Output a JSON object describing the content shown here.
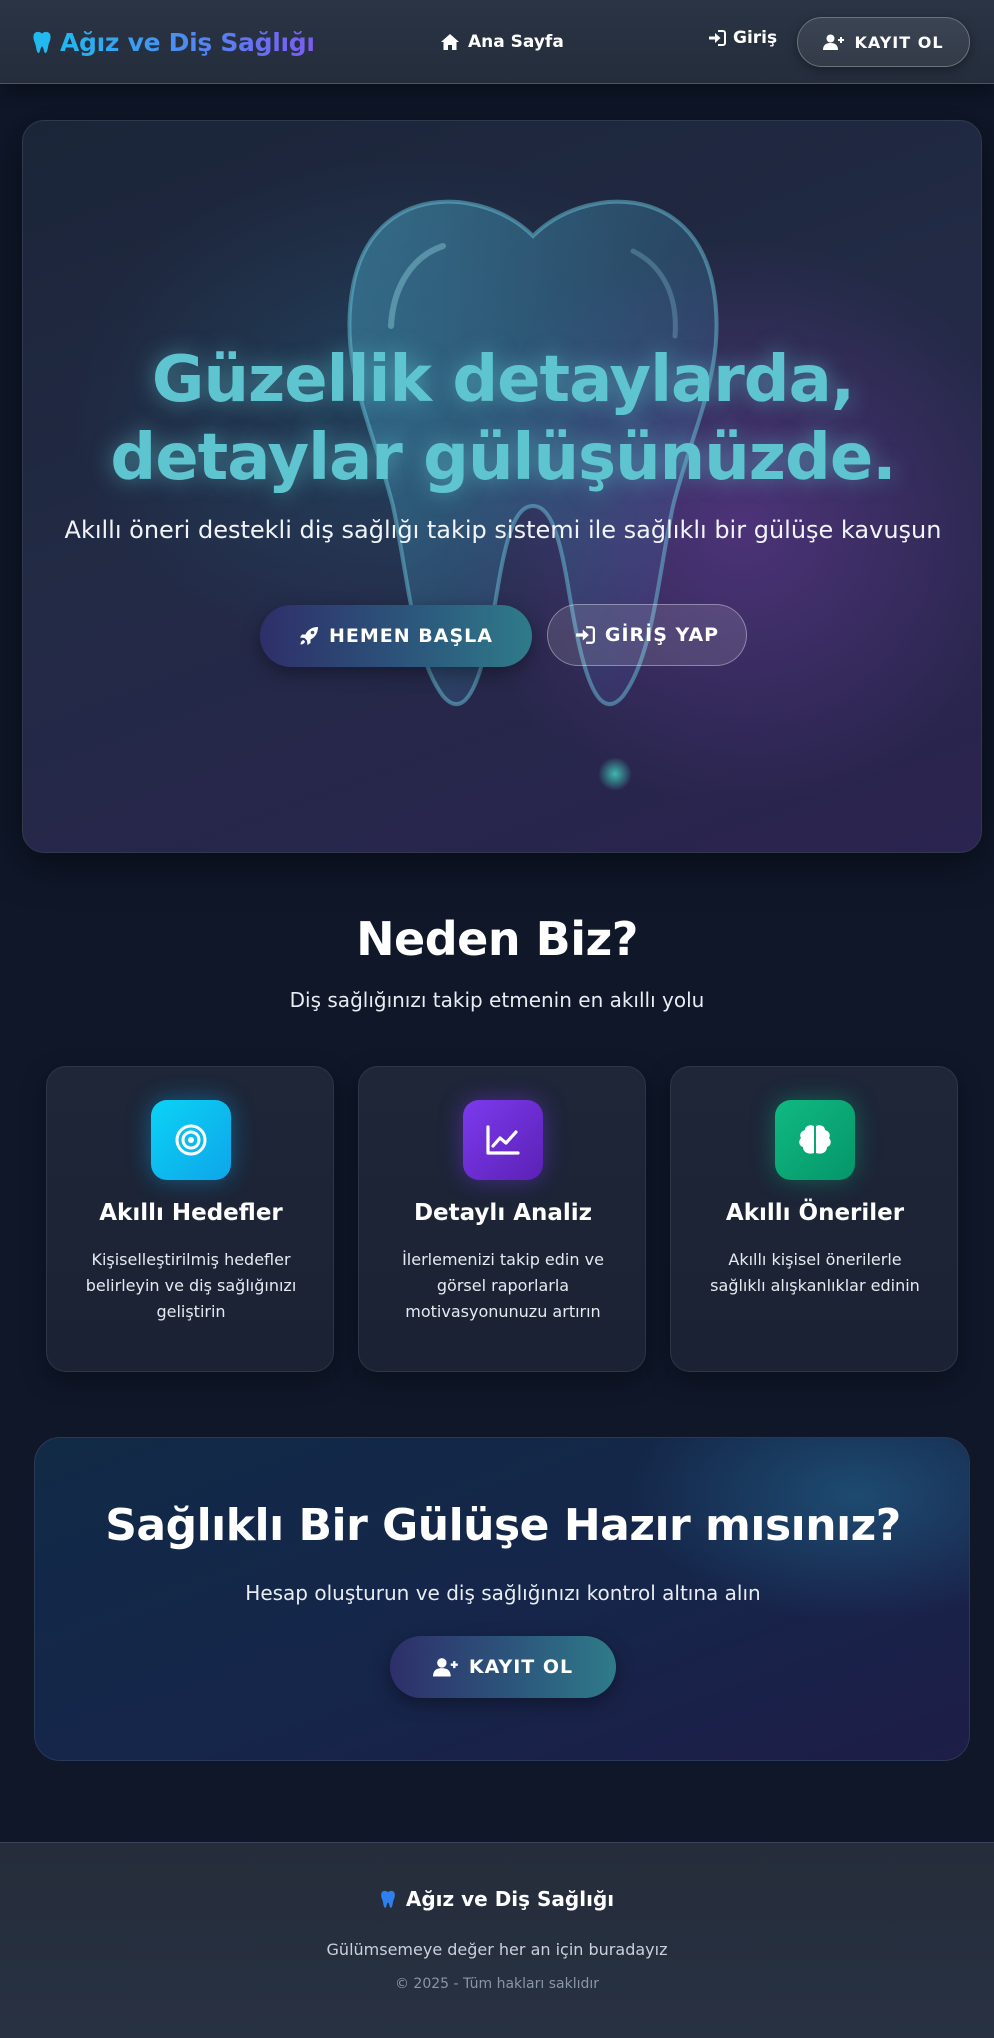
{
  "navbar": {
    "brand": "Ağız ve Diş Sağlığı",
    "brand_icon": "tooth-icon",
    "home_label": "Ana Sayfa",
    "login_label": "Giriş",
    "register_label": "KAYIT OL"
  },
  "hero": {
    "title_line1": "Güzellik detaylarda,",
    "title_line2": "detaylar gülüşünüzde.",
    "subtitle": "Akıllı öneri destekli diş sağlığı takip sistemi ile sağlıklı bir gülüşe kavuşun",
    "start_button": "HEMEN BAŞLA",
    "login_button": "GİRİŞ YAP"
  },
  "features": {
    "title": "Neden Biz?",
    "subtitle": "Diş sağlığınızı takip etmenin en akıllı yolu",
    "cards": [
      {
        "icon": "target-icon",
        "color": "#0ea5e9",
        "title": "Akıllı Hedefler",
        "description": "Kişiselleştirilmiş hedefler belirleyin ve diş sağlığınızı geliştirin"
      },
      {
        "icon": "chart-line-icon",
        "color": "#6d28d9",
        "title": "Detaylı Analiz",
        "description": "İlerlemenizi takip edin ve görsel raporlarla motivasyonunuzu artırın"
      },
      {
        "icon": "brain-icon",
        "color": "#10b981",
        "title": "Akıllı Öneriler",
        "description": "Akıllı kişisel önerilerle sağlıklı alışkanlıklar edinin"
      }
    ]
  },
  "cta": {
    "title": "Sağlıklı Bir Gülüşe Hazır mısınız?",
    "subtitle": "Hesap oluşturun ve diş sağlığınızı kontrol altına alın",
    "button": "KAYIT OL"
  },
  "footer": {
    "brand": "Ağız ve Diş Sağlığı",
    "tagline": "Gülümsemeye değer her an için buradayız",
    "copyright": "© 2025 - Tüm hakları saklıdır"
  }
}
